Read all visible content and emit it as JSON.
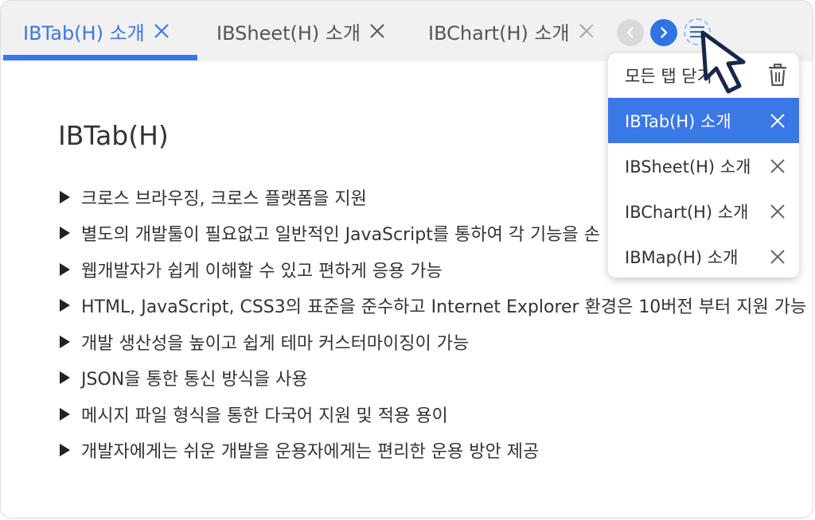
{
  "tabs": [
    {
      "label": "IBTab(H) 소개",
      "active": true
    },
    {
      "label": "IBSheet(H) 소개",
      "active": false
    },
    {
      "label": "IBChart(H) 소개",
      "active": false
    }
  ],
  "nav": {
    "prev_icon": "chevron-left-icon",
    "next_icon": "chevron-right-icon",
    "menu_icon": "hamburger-menu-icon"
  },
  "content": {
    "title": "IBTab(H)",
    "bullets": [
      "크로스 브라우징, 크로스 플랫폼을 지원",
      "별도의 개발툴이 필요없고 일반적인 JavaScript를 통하여 각 기능을 손",
      "웹개발자가 쉽게 이해할 수 있고 편하게 응용 가능",
      "HTML, JavaScript, CSS3의 표준을 준수하고 Internet Explorer 환경은 10버전 부터 지원 가능",
      "개발 생산성을 높이고 쉽게 테마 커스터마이징이 가능",
      "JSON을 통한 통신 방식을 사용",
      "메시지 파일 형식을 통한 다국어 지원 및 적용 용이",
      "개발자에게는 쉬운 개발을 운용자에게는 편리한 운용 방안 제공"
    ]
  },
  "dropdown": {
    "close_all_label": "모든 탭 닫기",
    "items": [
      {
        "label": "IBTab(H) 소개",
        "selected": true
      },
      {
        "label": "IBSheet(H) 소개",
        "selected": false
      },
      {
        "label": "IBChart(H) 소개",
        "selected": false
      },
      {
        "label": "IBMap(H) 소개",
        "selected": false
      }
    ]
  },
  "colors": {
    "accent": "#3a78e6",
    "tabbar_bg": "#f1f1f1",
    "text": "#333333"
  }
}
